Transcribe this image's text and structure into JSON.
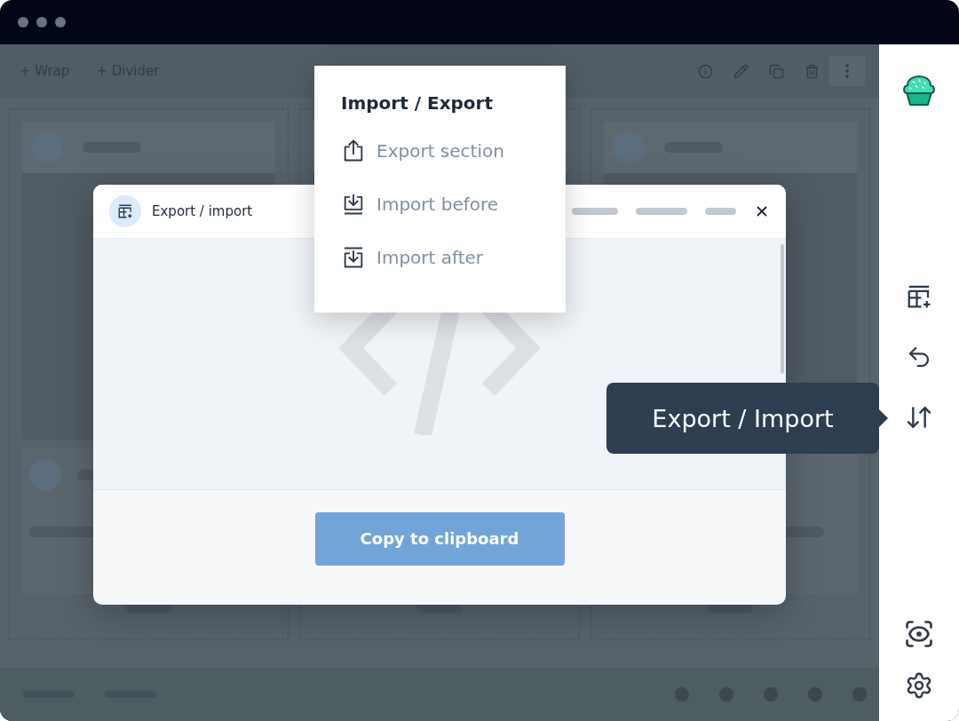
{
  "toolbar": {
    "actions": [
      "+ Wrap",
      "+ Divider"
    ]
  },
  "modal": {
    "title": "Export / import",
    "button": "Copy to clipboard"
  },
  "menu": {
    "title": "Import / Export",
    "items": [
      {
        "label": "Export section",
        "kind": "export"
      },
      {
        "label": "Import before",
        "kind": "before"
      },
      {
        "label": "Import after",
        "kind": "after"
      }
    ]
  },
  "tooltip": {
    "text": "Export / Import"
  }
}
